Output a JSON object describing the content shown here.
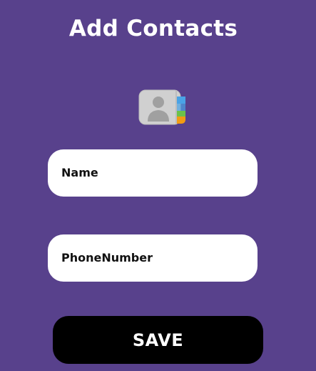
{
  "header": {
    "title": "Add Contacts"
  },
  "contacts_icon": {
    "icon": "contacts-book-icon",
    "colors": {
      "body": "#d0d0d0",
      "silhouette": "#a0a0a0",
      "tab_blue": "#4aa3e6",
      "tab_green": "#6cc24a",
      "tab_orange": "#f39c12"
    }
  },
  "form": {
    "name_placeholder": "Name",
    "phone_placeholder": "PhoneNumber",
    "save_label": "SAVE"
  },
  "colors": {
    "background": "#58418c",
    "field_background": "#ffffff",
    "button_background": "#000000",
    "button_text": "#ffffff"
  }
}
